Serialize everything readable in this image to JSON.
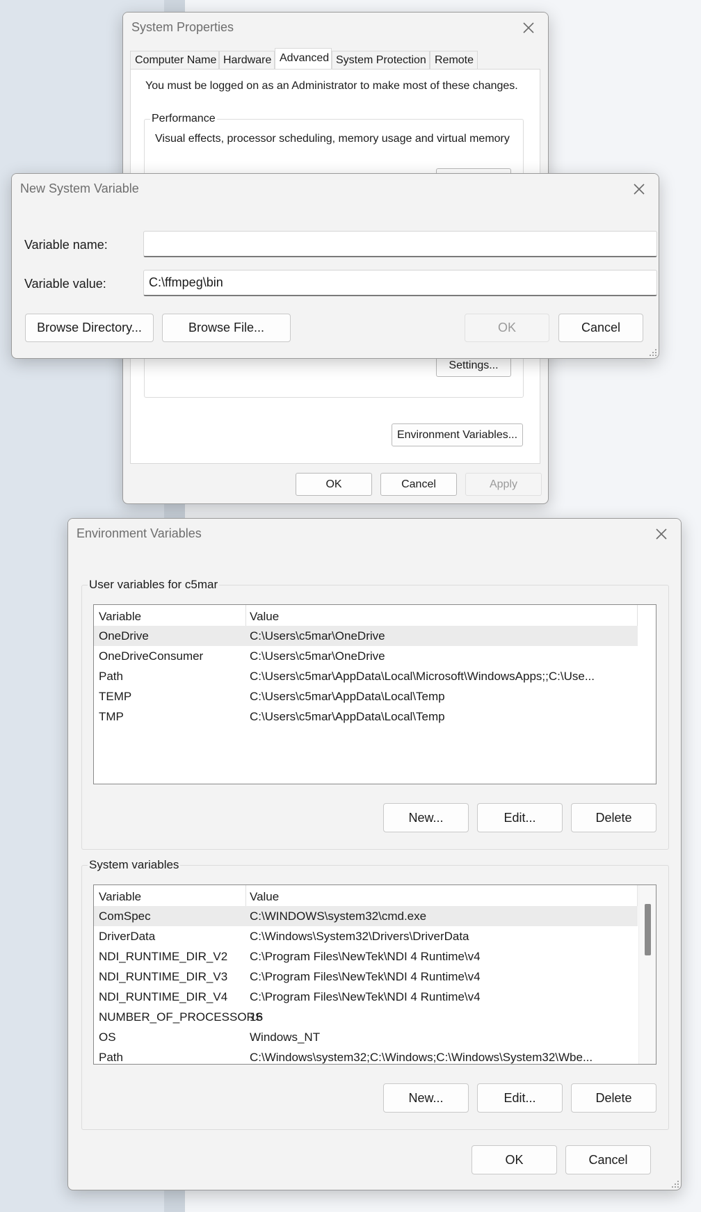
{
  "system_properties": {
    "title": "System Properties",
    "tabs": [
      {
        "label": "Computer Name"
      },
      {
        "label": "Hardware"
      },
      {
        "label": "Advanced"
      },
      {
        "label": "System Protection"
      },
      {
        "label": "Remote"
      }
    ],
    "active_tab": "Advanced",
    "admin_note": "You must be logged on as an Administrator to make most of these changes.",
    "performance_legend": "Performance",
    "performance_desc": "Visual effects, processor scheduling, memory usage and virtual memory",
    "settings_label": "Settings...",
    "env_vars_label": "Environment Variables...",
    "ok_label": "OK",
    "cancel_label": "Cancel",
    "apply_label": "Apply"
  },
  "new_system_variable": {
    "title": "New System Variable",
    "name_label": "Variable name:",
    "name_value": "",
    "value_label": "Variable value:",
    "value_value": "C:\\ffmpeg\\bin",
    "browse_dir_label": "Browse Directory...",
    "browse_file_label": "Browse File...",
    "ok_label": "OK",
    "cancel_label": "Cancel"
  },
  "environment_variables": {
    "title": "Environment Variables",
    "user_legend": "User variables for c5mar",
    "system_legend": "System variables",
    "col_variable": "Variable",
    "col_value": "Value",
    "user_rows": [
      {
        "name": "OneDrive",
        "value": "C:\\Users\\c5mar\\OneDrive"
      },
      {
        "name": "OneDriveConsumer",
        "value": "C:\\Users\\c5mar\\OneDrive"
      },
      {
        "name": "Path",
        "value": "C:\\Users\\c5mar\\AppData\\Local\\Microsoft\\WindowsApps;;C:\\Use..."
      },
      {
        "name": "TEMP",
        "value": "C:\\Users\\c5mar\\AppData\\Local\\Temp"
      },
      {
        "name": "TMP",
        "value": "C:\\Users\\c5mar\\AppData\\Local\\Temp"
      }
    ],
    "system_rows": [
      {
        "name": "ComSpec",
        "value": "C:\\WINDOWS\\system32\\cmd.exe"
      },
      {
        "name": "DriverData",
        "value": "C:\\Windows\\System32\\Drivers\\DriverData"
      },
      {
        "name": "NDI_RUNTIME_DIR_V2",
        "value": "C:\\Program Files\\NewTek\\NDI 4 Runtime\\v4"
      },
      {
        "name": "NDI_RUNTIME_DIR_V3",
        "value": "C:\\Program Files\\NewTek\\NDI 4 Runtime\\v4"
      },
      {
        "name": "NDI_RUNTIME_DIR_V4",
        "value": "C:\\Program Files\\NewTek\\NDI 4 Runtime\\v4"
      },
      {
        "name": "NUMBER_OF_PROCESSORS",
        "value": "16"
      },
      {
        "name": "OS",
        "value": "Windows_NT"
      },
      {
        "name": "Path",
        "value": "C:\\Windows\\system32;C:\\Windows;C:\\Windows\\System32\\Wbe..."
      }
    ],
    "new_label": "New...",
    "edit_label": "Edit...",
    "delete_label": "Delete",
    "ok_label": "OK",
    "cancel_label": "Cancel"
  }
}
